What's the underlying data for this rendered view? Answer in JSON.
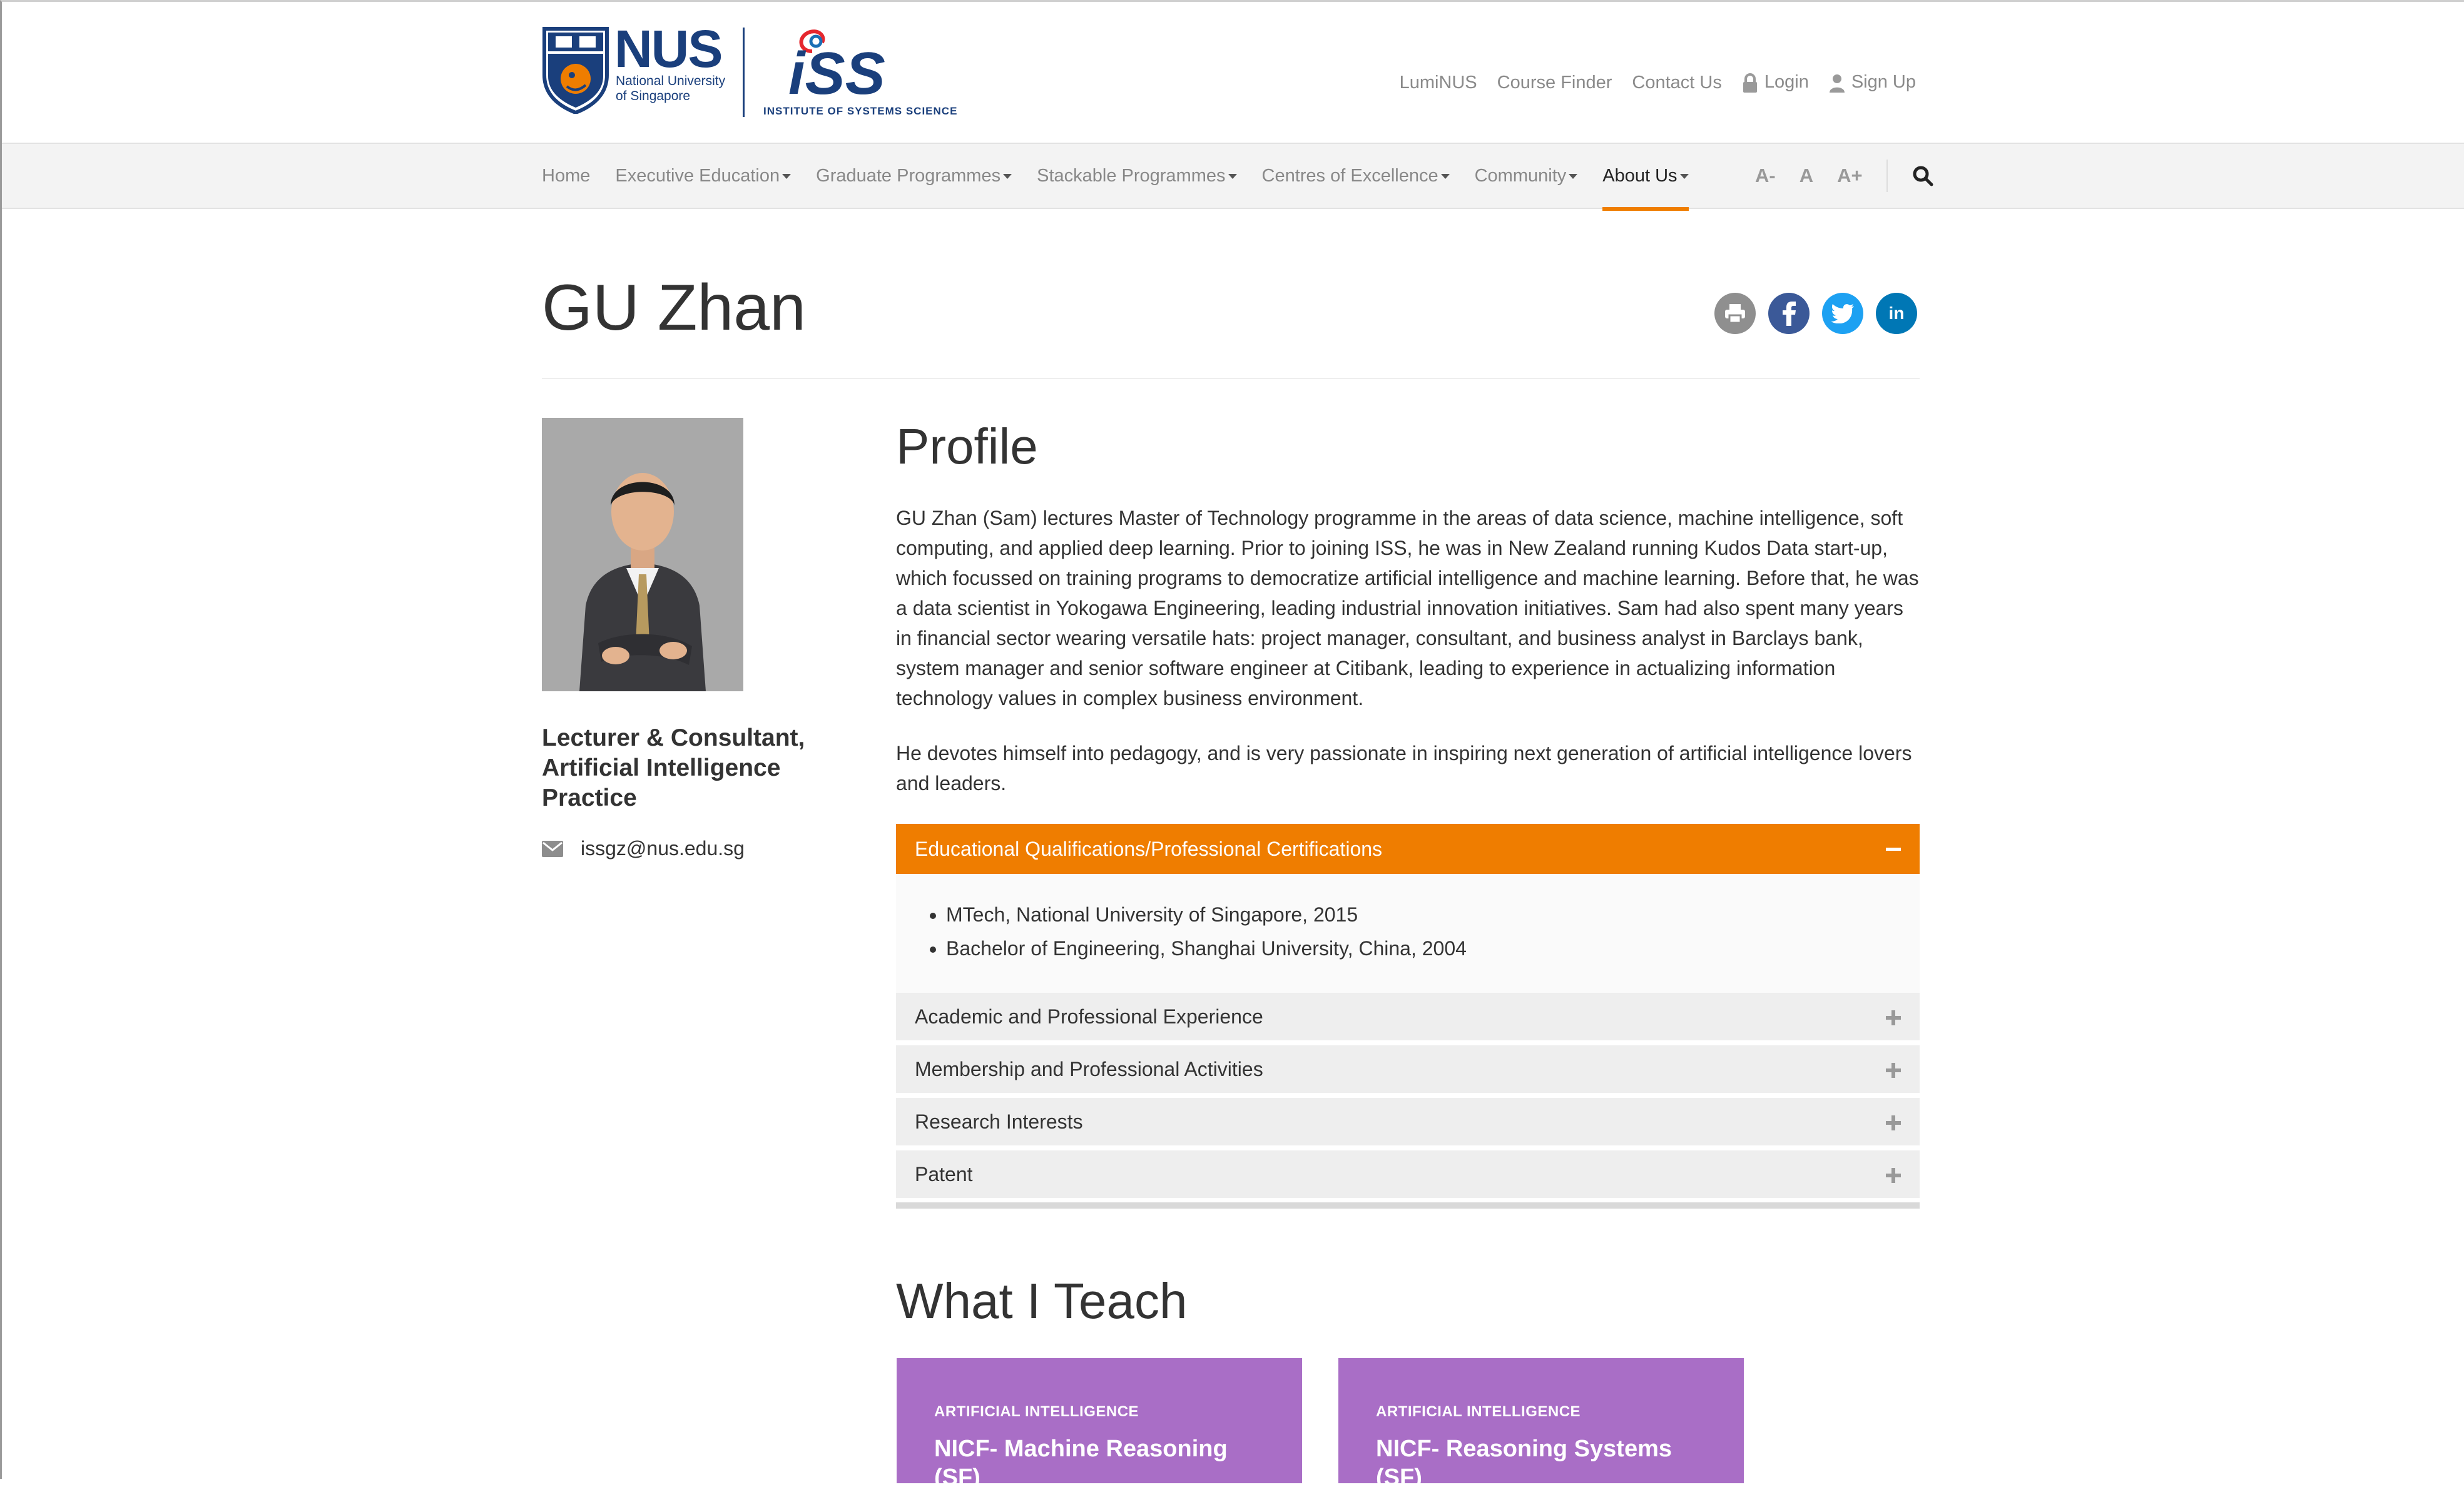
{
  "header": {
    "nus_logo": {
      "wordmark": "NUS",
      "line1": "National University",
      "line2": "of Singapore"
    },
    "iss_logo": {
      "wordmark": "iSS",
      "tagline": "INSTITUTE OF SYSTEMS SCIENCE"
    },
    "top_links": [
      "LumiNUS",
      "Course Finder",
      "Contact Us"
    ],
    "login_label": "Login",
    "signup_label": "Sign Up"
  },
  "nav": {
    "items": [
      {
        "label": "Home",
        "dropdown": false
      },
      {
        "label": "Executive Education",
        "dropdown": true
      },
      {
        "label": "Graduate Programmes",
        "dropdown": true
      },
      {
        "label": "Stackable Programmes",
        "dropdown": true
      },
      {
        "label": "Centres of Excellence",
        "dropdown": true
      },
      {
        "label": "Community",
        "dropdown": true
      },
      {
        "label": "About Us",
        "dropdown": true,
        "active": true
      }
    ],
    "font_decrease": "A-",
    "font_reset": "A",
    "font_increase": "A+"
  },
  "page": {
    "title": "GU Zhan",
    "share_colors": {
      "print": "#8f8f8f",
      "facebook": "#3b5998",
      "twitter": "#1da1f2",
      "linkedin": "#0077b5"
    },
    "linkedin_glyph": "in"
  },
  "profile": {
    "job_title": "Lecturer & Consultant, Artificial Intelligence Practice",
    "email": "issgz@nus.edu.sg",
    "heading": "Profile",
    "para1": "GU Zhan (Sam) lectures Master of Technology programme in the areas of data science, machine intelligence, soft computing, and applied deep learning. Prior to joining ISS, he was in New Zealand running Kudos Data start-up, which focussed on training programs to democratize artificial intelligence and machine learning.  Before that, he was a data scientist in Yokogawa Engineering, leading industrial innovation initiatives.  Sam had also spent many years in financial sector wearing versatile hats: project manager, consultant, and business analyst in Barclays bank, system manager and senior software engineer at Citibank, leading to experience in actualizing information technology values in complex business environment.",
    "para2": "He devotes himself into pedagogy, and is very passionate in inspiring next generation of artificial intelligence lovers and leaders."
  },
  "accordion": {
    "open": {
      "title": "Educational Qualifications/Professional Certifications",
      "items": [
        "MTech, National University of Singapore, 2015",
        "Bachelor of Engineering, Shanghai University, China, 2004"
      ]
    },
    "closed": [
      "Academic and Professional Experience",
      "Membership and Professional Activities",
      "Research Interests",
      "Patent"
    ],
    "accent_color": "#ef7d00"
  },
  "teach": {
    "heading": "What I Teach",
    "cards": [
      {
        "category": "ARTIFICIAL INTELLIGENCE",
        "name": "NICF- Machine Reasoning (SF)"
      },
      {
        "category": "ARTIFICIAL INTELLIGENCE",
        "name": "NICF- Reasoning Systems (SF)"
      }
    ],
    "card_color": "#a96ec6"
  }
}
